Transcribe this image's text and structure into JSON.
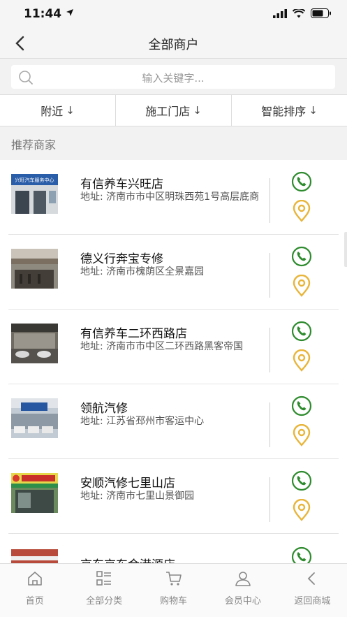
{
  "status_bar": {
    "time": "11:44"
  },
  "nav": {
    "title": "全部商户"
  },
  "search": {
    "placeholder": "输入关键字..."
  },
  "filters": [
    {
      "label": "附近",
      "arrow": "↓"
    },
    {
      "label": "施工门店",
      "arrow": "↓"
    },
    {
      "label": "智能排序",
      "arrow": "↓"
    }
  ],
  "section": {
    "title": "推荐商家"
  },
  "stores": [
    {
      "name": "有信养车兴旺店",
      "address": "地址: 济南市市中区明珠西苑1号高层底商",
      "sign": "兴旺汽车服务中心"
    },
    {
      "name": "德义行奔宝专修",
      "address": "地址: 济南市槐荫区全景嘉园"
    },
    {
      "name": "有信养车二环西路店",
      "address": "地址: 济南市市中区二环西路黑客帝国"
    },
    {
      "name": "领航汽修",
      "address": "地址: 江苏省邳州市客运中心"
    },
    {
      "name": "安顺汽修七里山店",
      "address": "地址: 济南市七里山景御园"
    },
    {
      "name": "京东京东金港源店",
      "address": ""
    }
  ],
  "tabbar": [
    {
      "label": "首页",
      "icon": "home-icon"
    },
    {
      "label": "全部分类",
      "icon": "category-icon"
    },
    {
      "label": "购物车",
      "icon": "cart-icon"
    },
    {
      "label": "会员中心",
      "icon": "user-icon"
    },
    {
      "label": "返回商城",
      "icon": "back-icon"
    }
  ],
  "colors": {
    "phone": "#2e8b2e",
    "location": "#e8b53a",
    "text_gray": "#888888"
  }
}
